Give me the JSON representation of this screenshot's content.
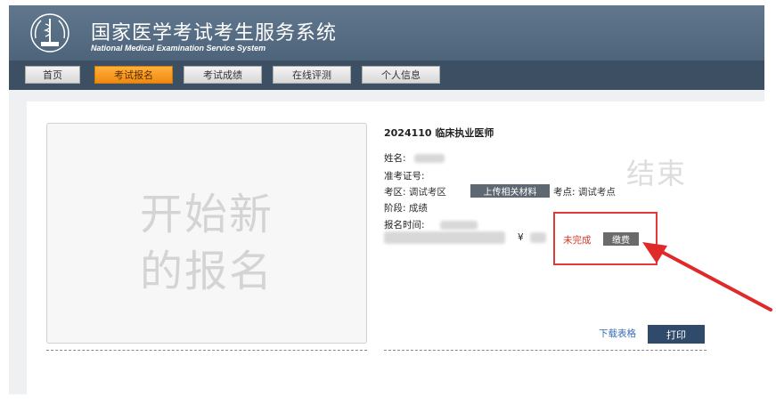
{
  "header": {
    "title": "国家医学考试考生服务系统",
    "subtitle": "National Medical Examination Service System"
  },
  "nav": {
    "items": [
      {
        "label": "首页"
      },
      {
        "label": "考试报名",
        "active": true
      },
      {
        "label": "考试成绩"
      },
      {
        "label": "在线评测"
      },
      {
        "label": "个人信息"
      }
    ]
  },
  "new_registration": {
    "line1": "开始新",
    "line2": "的报名"
  },
  "exam": {
    "title": "2024110 临床执业医师",
    "name_label": "姓名:",
    "ticket_label": "准考证号:",
    "region_label": "考区:",
    "region_value": "调试考区",
    "upload_button": "上传相关材料",
    "site_label": "考点:",
    "site_value": "调试考点",
    "stage_label": "阶段:",
    "stage_value": "成绩",
    "reg_time_label": "报名时间:",
    "currency_symbol": "¥",
    "status": "未完成",
    "pay_button": "缴费",
    "ended_stamp": "结束",
    "download_link": "下载表格",
    "print_button": "打印"
  },
  "colors": {
    "header_bg": "#5a6f86",
    "nav_bg": "#3d4f63",
    "nav_active": "#f39a1c",
    "status_red": "#d43a2a",
    "highlight_red": "#e23a3a",
    "print_bg": "#2f4a6a"
  }
}
